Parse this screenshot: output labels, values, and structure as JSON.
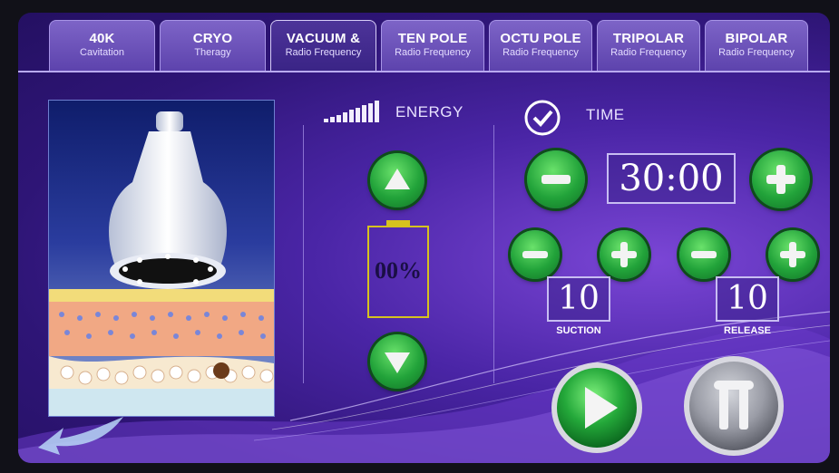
{
  "tabs": [
    {
      "title": "40K",
      "subtitle": "Cavitation",
      "active": false
    },
    {
      "title": "CRYO",
      "subtitle": "Theragy",
      "active": false
    },
    {
      "title": "VACUUM &",
      "subtitle": "Radio Frequency",
      "active": true
    },
    {
      "title": "TEN POLE",
      "subtitle": "Radio Frequency",
      "active": false
    },
    {
      "title": "OCTU POLE",
      "subtitle": "Radio Frequency",
      "active": false
    },
    {
      "title": "TRIPOLAR",
      "subtitle": "Radio Frequency",
      "active": false
    },
    {
      "title": "BIPOLAR",
      "subtitle": "Radio Frequency",
      "active": false
    }
  ],
  "energy": {
    "label": "ENERGY",
    "level_text": "00%",
    "icon": "signal-bars-icon"
  },
  "time": {
    "label": "TIME",
    "value": "30:00",
    "icon": "check-circle-icon"
  },
  "suction": {
    "label": "SUCTION",
    "value": "10"
  },
  "release": {
    "label": "RELEASE",
    "value": "10"
  },
  "controls": {
    "play_icon": "play-icon",
    "pause_icon": "pause-icon"
  },
  "colors": {
    "button_green": "#22a33a",
    "battery_outline": "#d6c21f",
    "screen_bg": "#2e1576"
  }
}
